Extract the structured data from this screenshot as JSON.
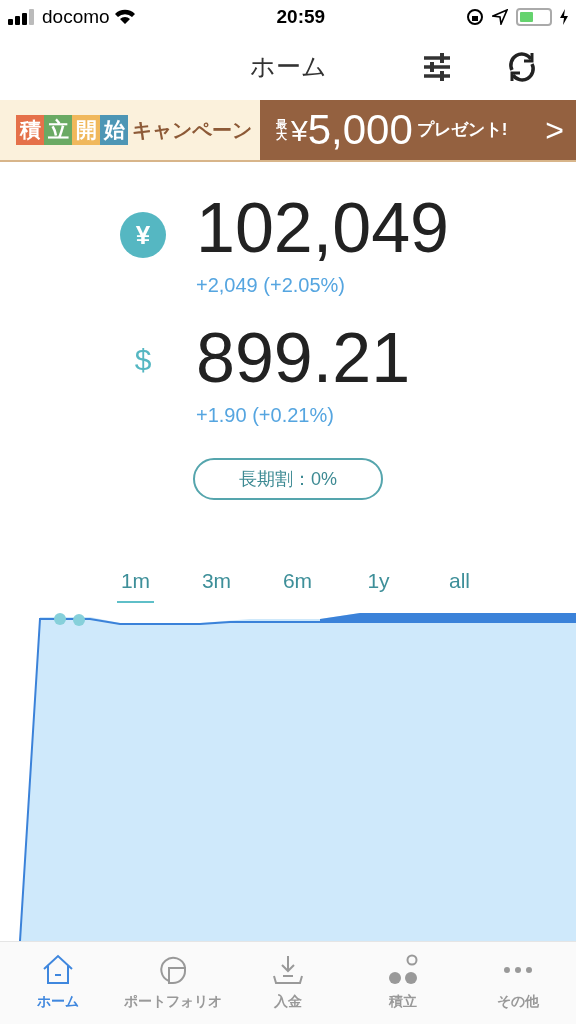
{
  "status_bar": {
    "carrier": "docomo",
    "time": "20:59"
  },
  "nav": {
    "title": "ホーム"
  },
  "banner": {
    "tiles": [
      {
        "text": "積",
        "color": "#e5714a"
      },
      {
        "text": "立",
        "color": "#6aaa64"
      },
      {
        "text": "開",
        "color": "#f0b85c"
      },
      {
        "text": "始",
        "color": "#4d96b5"
      }
    ],
    "campaign": "キャンペーン",
    "max_label_1": "最",
    "max_label_2": "大",
    "currency": "¥",
    "amount": "5,000",
    "present": "プレゼント!",
    "arrow": ">"
  },
  "balances": [
    {
      "kind": "yen",
      "symbol": "¥",
      "value": "102,049",
      "change": "+2,049 (+2.05%)"
    },
    {
      "kind": "dollar",
      "symbol": "$",
      "value": "899.21",
      "change": "+1.90 (+0.21%)"
    }
  ],
  "long_term_discount": "長期割：0%",
  "range_tabs": [
    {
      "label": "1m",
      "selected": true
    },
    {
      "label": "3m",
      "selected": false
    },
    {
      "label": "6m",
      "selected": false
    },
    {
      "label": "1y",
      "selected": false
    },
    {
      "label": "all",
      "selected": false
    }
  ],
  "tab_bar": [
    {
      "kind": "home",
      "label": "ホーム",
      "selected": true
    },
    {
      "kind": "portfolio",
      "label": "ポートフォリオ",
      "selected": false
    },
    {
      "kind": "deposit",
      "label": "入金",
      "selected": false
    },
    {
      "kind": "savings",
      "label": "積立",
      "selected": false
    },
    {
      "kind": "more",
      "label": "その他",
      "selected": false
    }
  ]
}
